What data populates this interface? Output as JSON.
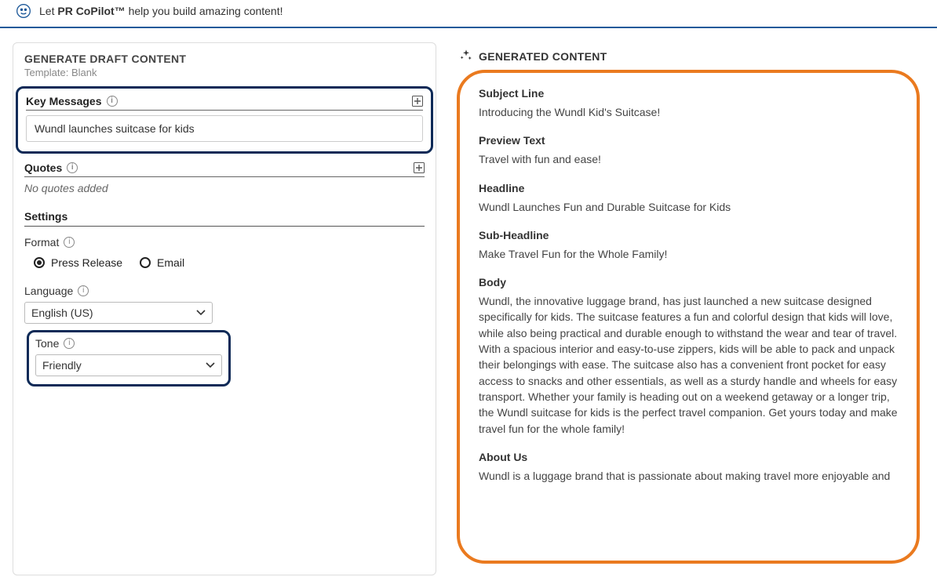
{
  "topbar": {
    "tagline_prefix": "Let ",
    "tagline_bold": "PR CoPilot™",
    "tagline_suffix": " help you build amazing content!"
  },
  "left": {
    "title": "GENERATE DRAFT CONTENT",
    "template_label": "Template: Blank",
    "key_messages": {
      "label": "Key Messages",
      "value": "Wundl launches suitcase for kids"
    },
    "quotes": {
      "label": "Quotes",
      "empty": "No quotes added"
    },
    "settings": {
      "header": "Settings",
      "format_label": "Format",
      "format_options": {
        "press_release": "Press Release",
        "email": "Email"
      },
      "language_label": "Language",
      "language_value": "English (US)",
      "tone_label": "Tone",
      "tone_value": "Friendly"
    }
  },
  "right": {
    "header": "GENERATED CONTENT",
    "sections": {
      "subject_label": "Subject Line",
      "subject_text": "Introducing the Wundl Kid's Suitcase!",
      "preview_label": "Preview Text",
      "preview_text": "Travel with fun and ease!",
      "headline_label": "Headline",
      "headline_text": "Wundl Launches Fun and Durable Suitcase for Kids",
      "subheadline_label": "Sub-Headline",
      "subheadline_text": "Make Travel Fun for the Whole Family!",
      "body_label": "Body",
      "body_text": "Wundl, the innovative luggage brand, has just launched a new suitcase designed specifically for kids. The suitcase features a fun and colorful design that kids will love, while also being practical and durable enough to withstand the wear and tear of travel. With a spacious interior and easy-to-use zippers, kids will be able to pack and unpack their belongings with ease. The suitcase also has a convenient front pocket for easy access to snacks and other essentials, as well as a sturdy handle and wheels for easy transport. Whether your family is heading out on a weekend getaway or a longer trip, the Wundl suitcase for kids is the perfect travel companion. Get yours today and make travel fun for the whole family!",
      "about_label": "About Us",
      "about_text": "Wundl is a luggage brand that is passionate about making travel more enjoyable and"
    }
  }
}
